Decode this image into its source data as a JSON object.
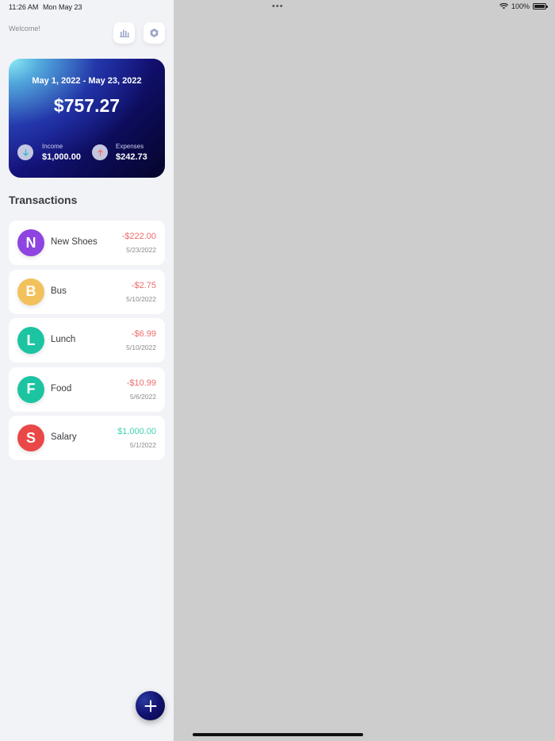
{
  "status_bar": {
    "time": "11:26 AM",
    "date": "Mon May 23",
    "more": "•••",
    "battery": "100%"
  },
  "header": {
    "welcome": "Welcome!",
    "stats_icon": "bar-chart-icon",
    "settings_icon": "gear-icon"
  },
  "summary": {
    "period": "May 1, 2022 - May 23, 2022",
    "balance": "$757.27",
    "income": {
      "label": "Income",
      "value": "$1,000.00",
      "icon": "arrow-down-icon"
    },
    "expenses": {
      "label": "Expenses",
      "value": "$242.73",
      "icon": "arrow-up-icon"
    }
  },
  "transactions": {
    "title": "Transactions",
    "items": [
      {
        "initial": "N",
        "name": "New Shoes",
        "amount": "-$222.00",
        "date": "5/23/2022",
        "color": "#8e44e0",
        "type": "expense"
      },
      {
        "initial": "B",
        "name": "Bus",
        "amount": "-$2.75",
        "date": "5/10/2022",
        "color": "#f3c15c",
        "type": "expense"
      },
      {
        "initial": "L",
        "name": "Lunch",
        "amount": "-$6.99",
        "date": "5/10/2022",
        "color": "#1dc4a2",
        "type": "expense"
      },
      {
        "initial": "F",
        "name": "Food",
        "amount": "-$10.99",
        "date": "5/6/2022",
        "color": "#1dc4a2",
        "type": "expense"
      },
      {
        "initial": "S",
        "name": "Salary",
        "amount": "$1,000.00",
        "date": "5/1/2022",
        "color": "#ea4848",
        "type": "income"
      }
    ]
  },
  "fab": {
    "icon": "plus-icon"
  },
  "colors": {
    "expense": "#ef6b6b",
    "income": "#3fd0b0",
    "sidebar_bg": "#f2f3f7",
    "detail_bg": "#cdcdcd"
  }
}
